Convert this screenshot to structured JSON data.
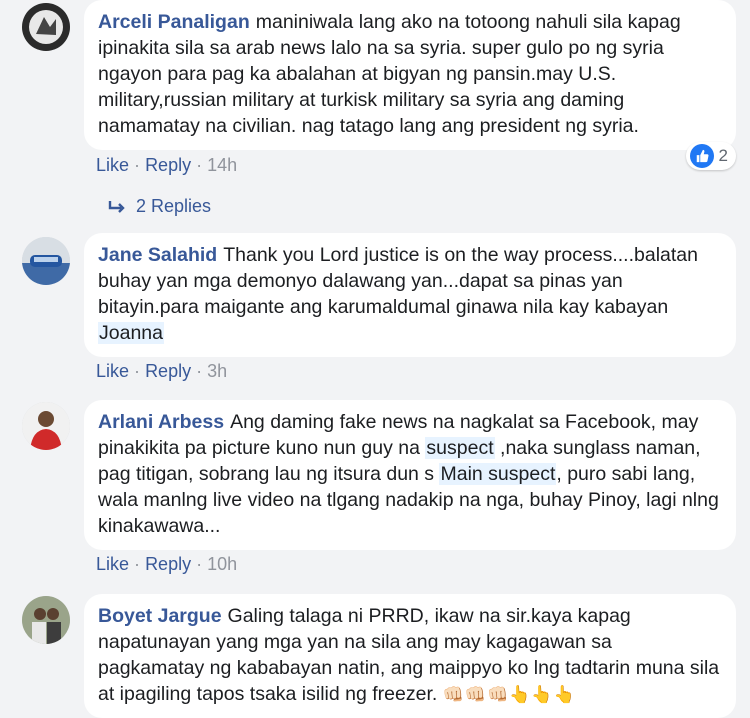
{
  "colors": {
    "link": "#385898",
    "muted": "#90949c",
    "bubble": "#ffffff",
    "background": "#f2f3f5",
    "like_blue": "#2078f4"
  },
  "action_labels": {
    "like": "Like",
    "separator": "·",
    "reply": "Reply"
  },
  "comments": [
    {
      "author": "Arceli Panaligan",
      "text": "maniniwala lang ako na totoong nahuli sila kapag ipinakita sila sa arab news lalo na sa syria. super gulo po ng syria ngayon para pag ka abalahan at bigyan ng pansin.may U.S. military,russian military at turkisk military sa syria ang daming namamatay na civilian. nag tatago lang ang president ng syria.",
      "time": "14h",
      "reaction_count": "2",
      "replies_label": "2 Replies"
    },
    {
      "author": "Jane Salahid",
      "text": "Thank you Lord justice is on the way process....balatan buhay yan mga demonyo dalawang yan...dapat sa pinas yan bitayin.para maigante ang karumaldumal ginawa nila kay kabayan",
      "tag": "Joanna",
      "time": "3h"
    },
    {
      "author": "Arlani Arbess",
      "text_1": "Ang daming fake news na nagkalat sa Facebook, may pinakikita pa picture kuno nun guy na",
      "tag_1": "suspect",
      "text_2": ",naka sunglass naman, pag titigan, sobrang lau ng itsura dun s",
      "tag_2": "Main suspect",
      "text_3": ", puro sabi lang, wala manlng live video na tlgang nadakip na nga, buhay Pinoy, lagi nlng kinakawawa...",
      "time": "10h"
    },
    {
      "author": "Boyet Jargue",
      "text": "Galing talaga ni PRRD, ikaw na sir.kaya kapag napatunayan yang mga yan na sila ang may kagagawan sa pagkamatay ng kababayan natin, ang maippyo ko lng tadtarin muna sila at ipagiling tapos tsaka isilid ng freezer.",
      "emoji": "👊🏻👊🏻👊🏻👆👆👆"
    }
  ]
}
